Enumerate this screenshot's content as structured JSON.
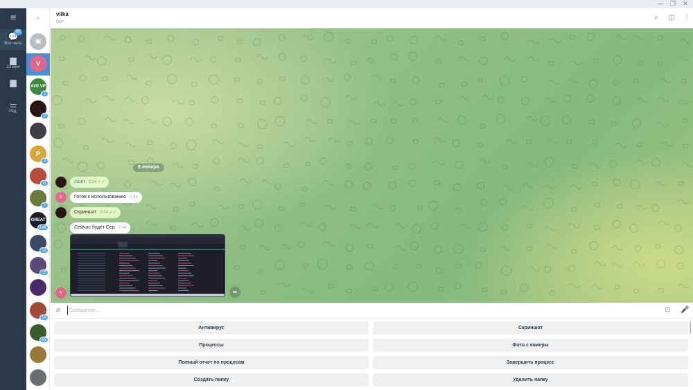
{
  "window": {
    "controls": [
      "—",
      "❐",
      "✕"
    ]
  },
  "rail": {
    "menu_icon": "menu-icon",
    "items": [
      {
        "label": "Все чаты",
        "badge": "66",
        "icon": "chat-bubbles-icon"
      },
      {
        "label": "13 мин",
        "badge": "",
        "icon": "folder-icon"
      },
      {
        "label": "",
        "badge": "",
        "icon": "folder-icon"
      },
      {
        "label": "Ред.",
        "badge": "",
        "icon": "sliders-icon"
      }
    ]
  },
  "chatlist": {
    "rows": [
      {
        "initials": "",
        "color": "#b8bec4",
        "badge": "",
        "icon": "archive-icon"
      },
      {
        "initials": "V",
        "color": "#e0678a",
        "badge": ""
      },
      {
        "initials": "AVE VP",
        "color": "#3d8a3e",
        "badge": "2"
      },
      {
        "initials": "",
        "color": "#2a1416",
        "badge": "2"
      },
      {
        "initials": "",
        "color": "#3e4045",
        "badge": ""
      },
      {
        "initials": "P",
        "color": "#d8a53a",
        "badge": "3"
      },
      {
        "initials": "",
        "color": "#b54c3b",
        "badge": "11"
      },
      {
        "initials": "",
        "color": "#6a7a3a",
        "badge": "1"
      },
      {
        "initials": "GREAT",
        "color": "#1d1f26",
        "badge": "146"
      },
      {
        "initials": "",
        "color": "#3c4a6a",
        "badge": "19"
      },
      {
        "initials": "",
        "color": "#5a4a7a",
        "badge": "25"
      },
      {
        "initials": "",
        "color": "#4a2a6a",
        "badge": ""
      },
      {
        "initials": "",
        "color": "#a04a3a",
        "badge": "59"
      },
      {
        "initials": "",
        "color": "#3a5a2a",
        "badge": "65"
      },
      {
        "initials": "",
        "color": "#9a7a3a",
        "badge": ""
      },
      {
        "initials": "",
        "color": "#6a6e73",
        "badge": ""
      }
    ]
  },
  "header": {
    "title": "vilka",
    "status": "бот",
    "icons": [
      "search-icon",
      "sidebar-icon",
      "more-icon"
    ]
  },
  "chat": {
    "date": "8 января",
    "messages": [
      {
        "dir": "out",
        "text": "/start",
        "time": "0:34",
        "read": true,
        "is_command": true
      },
      {
        "dir": "in",
        "text": "Готов к использованию",
        "time": "0:34",
        "read": false
      },
      {
        "dir": "out",
        "text": "Скриншот",
        "time": "0:34",
        "read": true
      },
      {
        "dir": "in",
        "text": "Сейчас будет Сер",
        "time": "0:34",
        "read": false
      }
    ],
    "avatar_out_color": "#2a1416",
    "avatar_in_initial": "V",
    "avatar_in_color": "#e0678a"
  },
  "composer": {
    "placeholder": "Сообщение..."
  },
  "keyboard": {
    "buttons": [
      [
        "Антивирус",
        "Скриншот"
      ],
      [
        "Процессы",
        "Фото с камеры"
      ],
      [
        "Полный отчет по процесам",
        "Завершить процесс"
      ],
      [
        "Создать папку",
        "Удалить папку"
      ]
    ]
  }
}
